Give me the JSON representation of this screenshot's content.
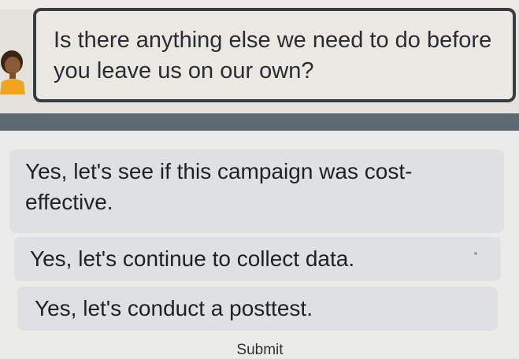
{
  "question": {
    "text": "Is there anything else we need to do before you leave us on our own?",
    "avatar_icon": "person-avatar-icon"
  },
  "options": [
    {
      "label": "Yes, let's see if this campaign was cost-effective."
    },
    {
      "label": "Yes, let's continue to collect data."
    },
    {
      "label": "Yes, let's conduct a posttest."
    }
  ],
  "submit_label": "Submit",
  "colors": {
    "bubble_border": "#3a3d40",
    "divider": "#5d6a70",
    "option_bg": "#dfe0e2"
  }
}
